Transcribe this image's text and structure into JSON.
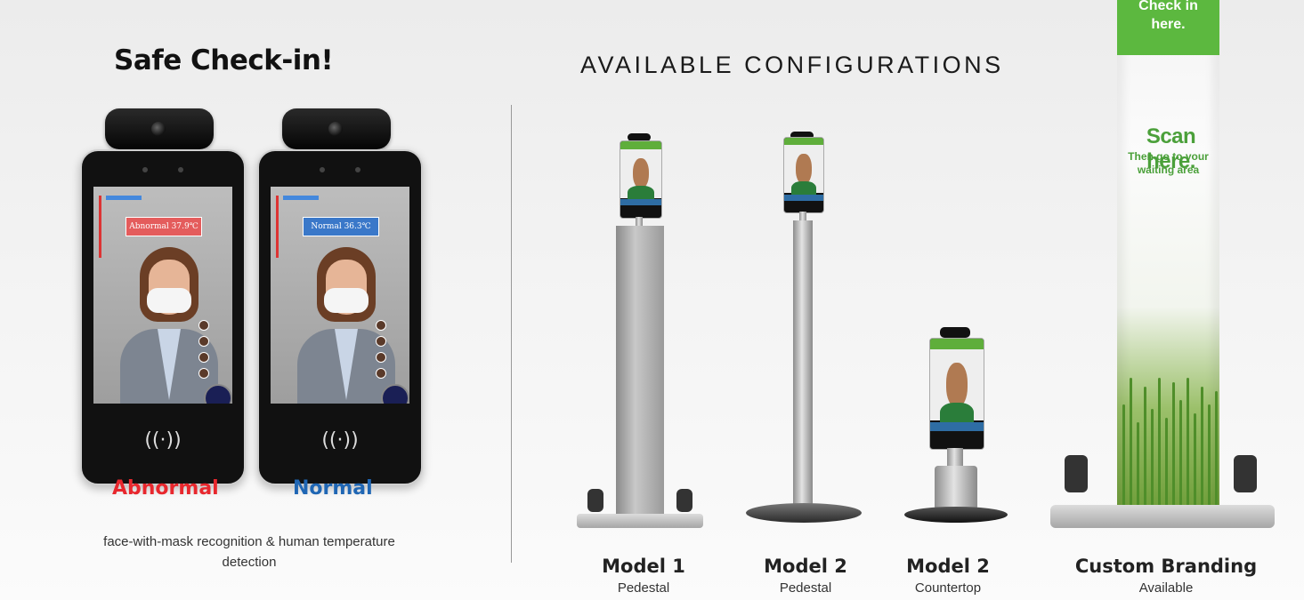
{
  "left_panel": {
    "title": "Safe Check-in!",
    "devices": [
      {
        "label": "Abnormal",
        "temp_tag": "Abnormal 37.9℃",
        "tag_color": "#e45c5c",
        "label_color": "#e8272d"
      },
      {
        "label": "Normal",
        "temp_tag": "Normal 36.3℃",
        "tag_color": "#3a78c9",
        "label_color": "#1f66b4"
      }
    ],
    "nfc_symbol": "((·))",
    "caption": "face-with-mask recognition & human temperature detection"
  },
  "right_panel": {
    "title": "AVAILABLE CONFIGURATIONS",
    "models": [
      {
        "name": "Model 1",
        "sub": "Pedestal"
      },
      {
        "name": "Model 2",
        "sub": "Pedestal"
      },
      {
        "name": "Model 2",
        "sub": "Countertop"
      },
      {
        "name": "Custom Branding",
        "sub": "Available"
      }
    ],
    "banner": {
      "check_line1": "Check in",
      "check_line2": "here.",
      "scan": "Scan here.",
      "then_line1": "Then go to your",
      "then_line2": "waiting area"
    }
  }
}
